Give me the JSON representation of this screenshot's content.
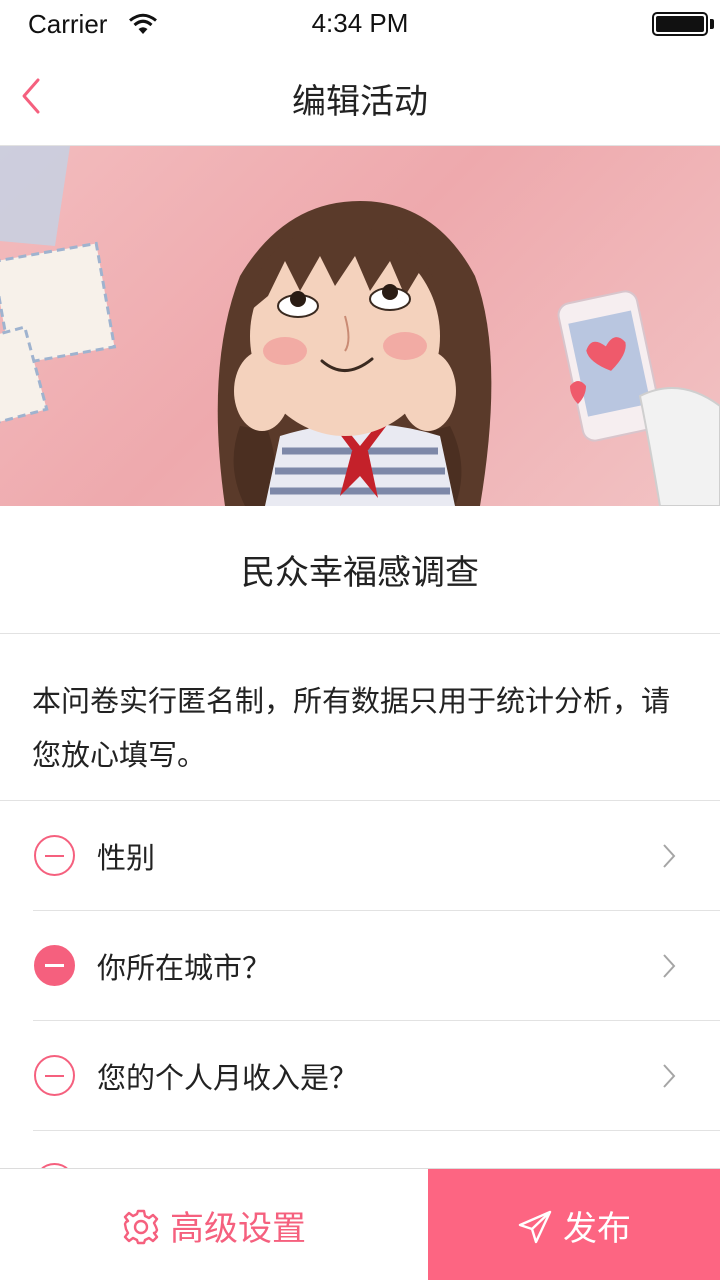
{
  "status_bar": {
    "carrier": "Carrier",
    "time": "4:34 PM"
  },
  "nav": {
    "title": "编辑活动",
    "back_icon": "chevron-left-icon"
  },
  "banner": {
    "description_icon": "banner-illustration"
  },
  "survey": {
    "title": "民众幸福感调查",
    "description": "本问卷实行匿名制，所有数据只用于统计分析，请您放心填写。"
  },
  "questions": [
    {
      "label": "性别",
      "minus_style": "outline"
    },
    {
      "label": "你所在城市？",
      "minus_style": "filled"
    },
    {
      "label": "您的个人月收入是？",
      "minus_style": "outline"
    }
  ],
  "bottom_bar": {
    "settings_label": "高级设置",
    "settings_icon": "gear-icon",
    "publish_label": "发布",
    "publish_icon": "send-icon"
  },
  "colors": {
    "accent": "#f5607e",
    "publish_bg": "#fd6582",
    "divider": "#e2e2e2"
  }
}
